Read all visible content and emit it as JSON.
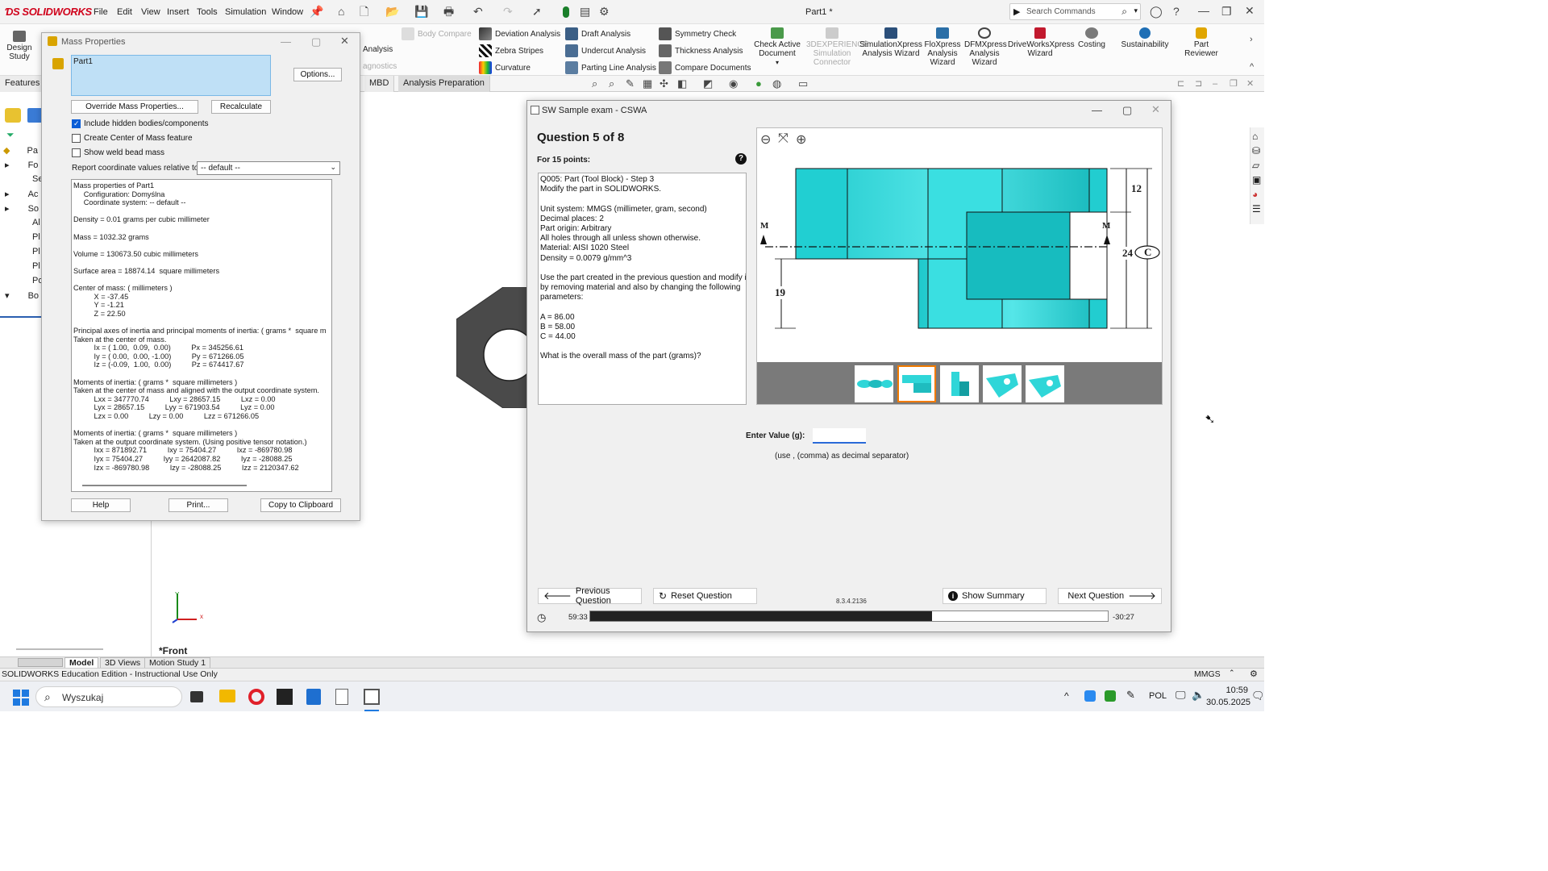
{
  "app": {
    "brand": "SOLIDWORKS",
    "doc_title": "Part1 *",
    "menu": [
      "File",
      "Edit",
      "View",
      "Insert",
      "Tools",
      "Simulation",
      "Window"
    ],
    "search_placeholder": "Search Commands"
  },
  "ribbon": {
    "design_study": "Design\nStudy",
    "body_compare": "Body Compare",
    "interference_analysis_partial": "Analysis",
    "diagnostics_partial": "agnostics",
    "deviation_analysis": "Deviation Analysis",
    "zebra_stripes": "Zebra Stripes",
    "curvature": "Curvature",
    "draft_analysis": "Draft Analysis",
    "undercut_analysis": "Undercut Analysis",
    "parting_line_analysis": "Parting Line Analysis",
    "symmetry_check": "Symmetry Check",
    "thickness_analysis": "Thickness Analysis",
    "compare_documents": "Compare Documents",
    "check_active_document": "Check Active\nDocument",
    "connector": "3DEXPERIENCE\nSimulation\nConnector",
    "simxpress": "SimulationXpress\nAnalysis Wizard",
    "floxpress": "FloXpress\nAnalysis\nWizard",
    "dfmxpress": "DFMXpress\nAnalysis\nWizard",
    "driveworks": "DriveWorksXpress\nWizard",
    "costing": "Costing",
    "sustainability": "Sustainability",
    "part_reviewer": "Part\nReviewer"
  },
  "tabs": {
    "features": "Features",
    "mbd": "MBD",
    "analysis_preparation": "Analysis Preparation"
  },
  "tree": {
    "root": "Pa",
    "items": [
      "Fo",
      "Se",
      "Ac",
      "So",
      "Al",
      "Pl",
      "Pl",
      "Pl",
      "Po",
      "Bo"
    ]
  },
  "mass_dialog": {
    "title": "Mass Properties",
    "selection": "Part1",
    "options_btn": "Options...",
    "override_btn": "Override Mass Properties...",
    "recalculate_btn": "Recalculate",
    "chk_hidden": "Include hidden bodies/components",
    "chk_hidden_checked": true,
    "chk_com": "Create Center of Mass feature",
    "chk_weld": "Show weld bead mass",
    "report_label": "Report coordinate values relative to:",
    "report_value": "-- default --",
    "results": [
      "Mass properties of Part1",
      "     Configuration: Domyślna",
      "     Coordinate system: -- default --",
      "",
      "Density = 0.01 grams per cubic millimeter",
      "",
      "Mass = 1032.32 grams",
      "",
      "Volume = 130673.50 cubic millimeters",
      "",
      "Surface area = 18874.14  square millimeters",
      "",
      "Center of mass: ( millimeters )",
      "          X = -37.45",
      "          Y = -1.21",
      "          Z = 22.50",
      "",
      "Principal axes of inertia and principal moments of inertia: ( grams *  square m",
      "Taken at the center of mass.",
      "          Ix = ( 1.00,  0.09,  0.00)          Px = 345256.61",
      "          Iy = ( 0.00,  0.00, -1.00)          Py = 671266.05",
      "          Iz = (-0.09,  1.00,  0.00)          Pz = 674417.67",
      "",
      "Moments of inertia: ( grams *  square millimeters )",
      "Taken at the center of mass and aligned with the output coordinate system.",
      "          Lxx = 347770.74          Lxy = 28657.15          Lxz = 0.00",
      "          Lyx = 28657.15          Lyy = 671903.54          Lyz = 0.00",
      "          Lzx = 0.00          Lzy = 0.00          Lzz = 671266.05",
      "",
      "Moments of inertia: ( grams *  square millimeters )",
      "Taken at the output coordinate system. (Using positive tensor notation.)",
      "          Ixx = 871892.71          Ixy = 75404.27          Ixz = -869780.98",
      "          Iyx = 75404.27          Iyy = 2642087.82          Iyz = -28088.25",
      "          Izx = -869780.98          Izy = -28088.25          Izz = 2120347.62"
    ],
    "help_btn": "Help",
    "print_btn": "Print...",
    "copy_btn": "Copy to Clipboard"
  },
  "exam": {
    "window_title": "SW Sample exam - CSWA",
    "question_heading": "Question 5 of 8",
    "points": "For 15 points:",
    "question_lines": [
      "Q005: Part (Tool Block) - Step 3",
      "Modify the part in SOLIDWORKS.",
      "",
      "Unit system: MMGS (millimeter, gram, second)",
      "Decimal places: 2",
      "Part origin: Arbitrary",
      "All holes through all unless shown otherwise.",
      "Material: AISI 1020 Steel",
      "Density = 0.0079 g/mm^3",
      "",
      "Use the part created in the previous question and modify it",
      "by removing material and also by changing the following",
      "parameters:",
      "",
      "A = 86.00",
      "B = 58.00",
      "C = 44.00",
      "",
      "What is the overall mass of the part (grams)?"
    ],
    "dims": {
      "d12": "12",
      "d24": "24",
      "d19": "19",
      "c": "C",
      "m": "M"
    },
    "enter_label": "Enter Value (g):",
    "enter_value": "",
    "separator_hint": "(use , (comma) as decimal separator)",
    "prev_btn": "Previous Question",
    "reset_btn": "Reset Question",
    "version": "8.3.4.2136",
    "summary_btn": "Show Summary",
    "next_btn": "Next Question",
    "time_elapsed": "59:33",
    "time_remaining": "-30:27",
    "progress_fraction": 0.66,
    "selected_thumb": 1
  },
  "viewport": {
    "view_label": "*Front",
    "axis_x": "x",
    "axis_y": "Y"
  },
  "bottom_tabs": [
    "Model",
    "3D Views",
    "Motion Study 1"
  ],
  "status": {
    "edition": "SOLIDWORKS Education Edition - Instructional Use Only",
    "units": "MMGS"
  },
  "taskbar": {
    "search_placeholder": "Wyszukaj",
    "lang": "POL",
    "time": "10:59",
    "date": "30.05.2025"
  },
  "colors": {
    "brand": "#d0021b",
    "part_cyan": "#2fd6d8",
    "accent": "#0b5ed7"
  }
}
